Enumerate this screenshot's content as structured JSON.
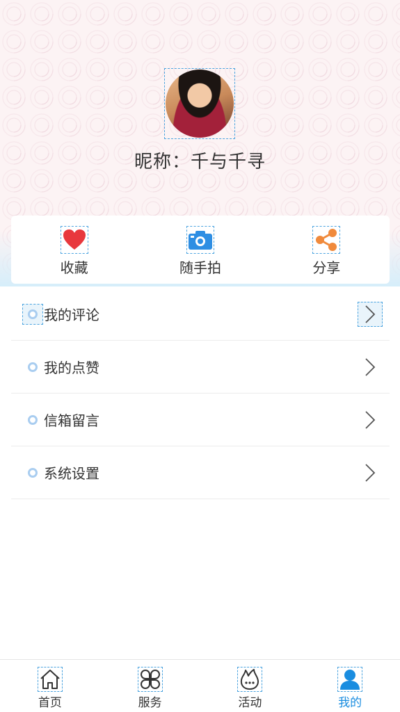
{
  "profile": {
    "nickname": "昵称：千与千寻"
  },
  "actions": [
    {
      "label": "收藏",
      "icon": "heart-icon"
    },
    {
      "label": "随手拍",
      "icon": "camera-icon"
    },
    {
      "label": "分享",
      "icon": "share-icon"
    }
  ],
  "menu": [
    {
      "label": "我的评论"
    },
    {
      "label": "我的点赞"
    },
    {
      "label": "信箱留言"
    },
    {
      "label": "系统设置"
    }
  ],
  "tabbar": [
    {
      "label": "首页",
      "icon": "home-icon"
    },
    {
      "label": "服务",
      "icon": "grid-icon"
    },
    {
      "label": "活动",
      "icon": "flame-icon"
    },
    {
      "label": "我的",
      "icon": "user-icon",
      "active": true
    }
  ],
  "colors": {
    "accent": "#1a8de0",
    "heart": "#e8383d",
    "camera": "#2e8ee3",
    "share": "#f08a3c",
    "dot": "#a9cdf0"
  }
}
